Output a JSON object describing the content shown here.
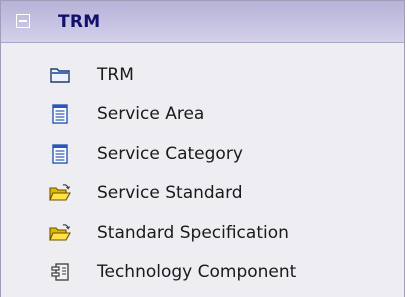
{
  "panel": {
    "title": "TRM",
    "collapse_symbol": "−",
    "items": [
      {
        "label": "TRM",
        "icon": "package-icon"
      },
      {
        "label": "Service Area",
        "icon": "document-icon"
      },
      {
        "label": "Service Category",
        "icon": "document-icon"
      },
      {
        "label": "Service Standard",
        "icon": "open-folder-icon"
      },
      {
        "label": "Standard Specification",
        "icon": "open-folder-icon"
      },
      {
        "label": "Technology Component",
        "icon": "component-icon"
      }
    ]
  },
  "colors": {
    "header_text": "#11116a",
    "header_bg": "#c6c2e2",
    "panel_bg": "#eeedf2"
  }
}
